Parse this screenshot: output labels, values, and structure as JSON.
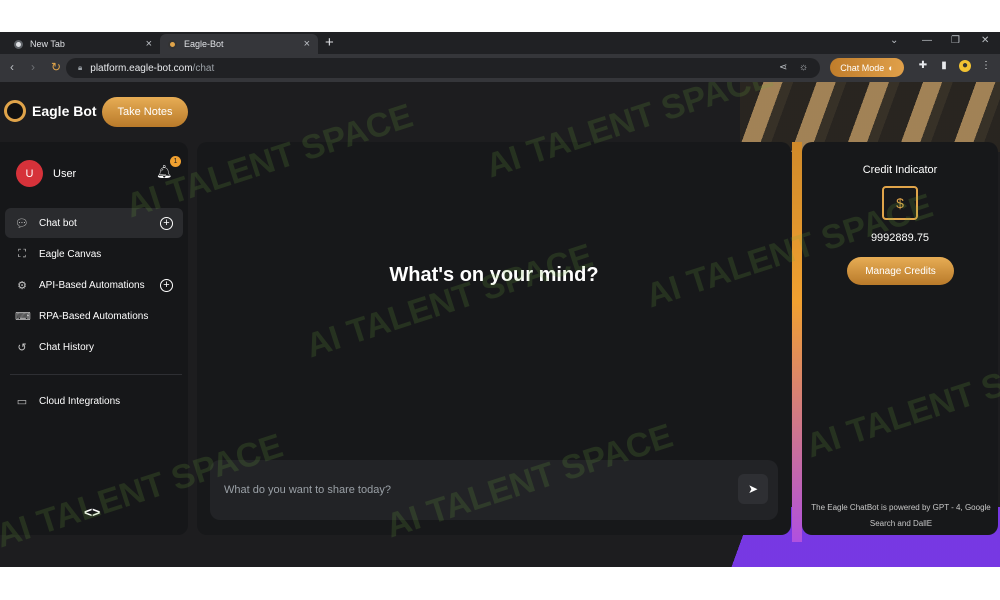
{
  "browser": {
    "tabs": [
      {
        "title": "New Tab",
        "close": "×"
      },
      {
        "title": "Eagle-Bot",
        "close": "×"
      }
    ],
    "new_tab": "+",
    "url_host": "platform.eagle-bot.com",
    "url_path": "/chat",
    "chat_mode_label": "Chat Mode"
  },
  "app": {
    "brand": "Eagle Bot",
    "take_notes_label": "Take Notes",
    "user": {
      "initial": "U",
      "name": "User",
      "notification_count": "1"
    },
    "nav": [
      {
        "label": "Chat bot",
        "icon": "chat-icon"
      },
      {
        "label": "Eagle Canvas",
        "icon": "canvas-icon"
      },
      {
        "label": "API-Based Automations",
        "icon": "gear-icon"
      },
      {
        "label": "RPA-Based Automations",
        "icon": "rpa-icon"
      },
      {
        "label": "Chat History",
        "icon": "history-icon"
      },
      {
        "label": "Cloud Integrations",
        "icon": "cloud-icon"
      }
    ],
    "headline": "What's on your mind?",
    "composer": {
      "placeholder": "What do you want to share today?"
    },
    "credit": {
      "title": "Credit Indicator",
      "amount": "9992889.75",
      "manage_label": "Manage Credits",
      "footer": "The Eagle ChatBot is powered by GPT - 4, Google Search and DallE"
    },
    "watermark": "AI TALENT SPACE",
    "colors": {
      "accent": "#d8963a",
      "brand_purple": "#7c3aed"
    }
  }
}
